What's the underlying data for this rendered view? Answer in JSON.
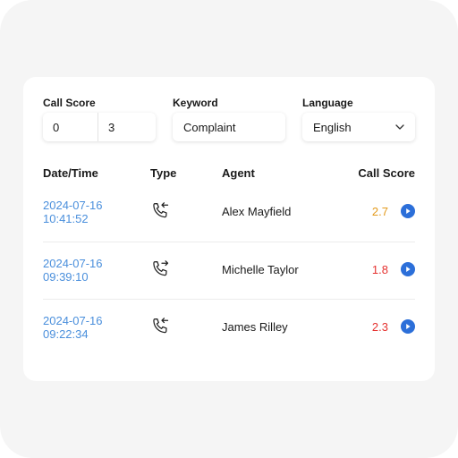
{
  "filters": {
    "call_score": {
      "label": "Call Score",
      "min": "0",
      "max": "3"
    },
    "keyword": {
      "label": "Keyword",
      "value": "Complaint"
    },
    "language": {
      "label": "Language",
      "value": "English"
    }
  },
  "table": {
    "headers": {
      "datetime": "Date/Time",
      "type": "Type",
      "agent": "Agent",
      "score": "Call Score"
    },
    "rows": [
      {
        "date": "2024-07-16",
        "time": "10:41:52",
        "type_icon": "incoming-call-icon",
        "agent": "Alex Mayfield",
        "score": "2.7",
        "score_color": "#e39a1c"
      },
      {
        "date": "2024-07-16",
        "time": "09:39:10",
        "type_icon": "outgoing-call-icon",
        "agent": "Michelle Taylor",
        "score": "1.8",
        "score_color": "#e5312f"
      },
      {
        "date": "2024-07-16",
        "time": "09:22:34",
        "type_icon": "incoming-call-icon",
        "agent": "James Rilley",
        "score": "2.3",
        "score_color": "#e5312f"
      }
    ]
  },
  "colors": {
    "link": "#4a8fdc",
    "play": "#2c6fd9"
  }
}
